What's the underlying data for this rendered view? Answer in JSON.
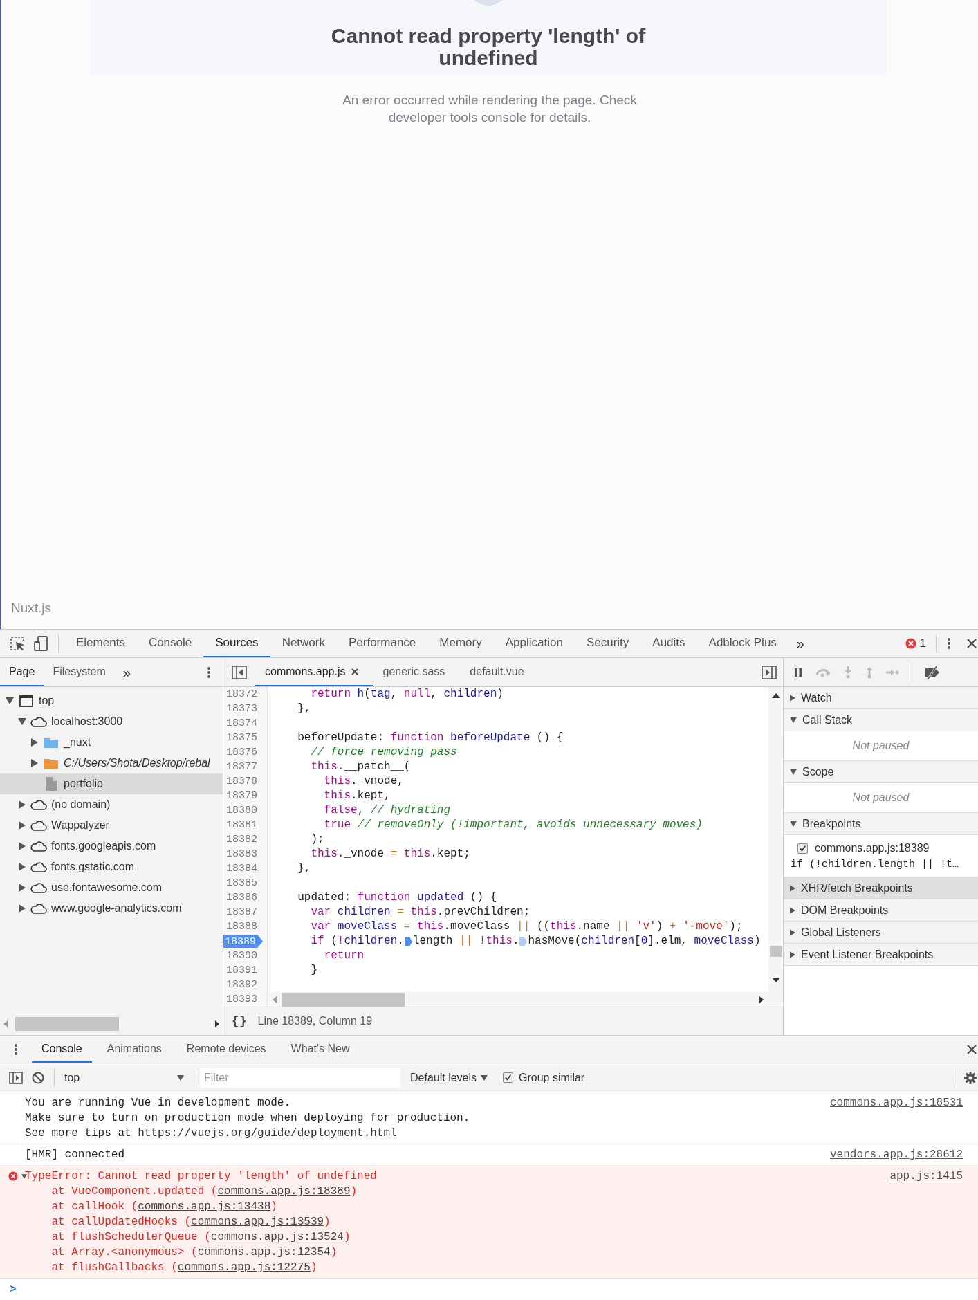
{
  "page": {
    "title": "Cannot read property 'length' of undefined",
    "message": "An error occurred while rendering the page. Check developer tools console for details.",
    "footer": "Nuxt.js"
  },
  "devtools": {
    "tabs": [
      {
        "label": "Elements",
        "selected": false
      },
      {
        "label": "Console",
        "selected": false
      },
      {
        "label": "Sources",
        "selected": true
      },
      {
        "label": "Network",
        "selected": false
      },
      {
        "label": "Performance",
        "selected": false
      },
      {
        "label": "Memory",
        "selected": false
      },
      {
        "label": "Application",
        "selected": false
      },
      {
        "label": "Security",
        "selected": false
      },
      {
        "label": "Audits",
        "selected": false
      },
      {
        "label": "Adblock Plus",
        "selected": false
      }
    ],
    "more_tabs": "»",
    "error_count": "1",
    "sources": {
      "navigator_tabs": [
        {
          "label": "Page",
          "selected": true
        },
        {
          "label": "Filesystem",
          "selected": false
        }
      ],
      "navigator_more": "»",
      "tree": [
        {
          "label": "top",
          "kind": "frame",
          "expanded": true,
          "selected": false,
          "children": [
            {
              "label": "localhost:3000",
              "kind": "domain",
              "expanded": true,
              "selected": false,
              "children": [
                {
                  "label": "_nuxt",
                  "kind": "folder",
                  "expanded": false,
                  "selected": false
                },
                {
                  "label": "C:/Users/Shota/Desktop/rebal",
                  "kind": "mapped-folder",
                  "expanded": false,
                  "selected": false
                },
                {
                  "label": "portfolio",
                  "kind": "file",
                  "selected": true
                }
              ]
            },
            {
              "label": "(no domain)",
              "kind": "domain",
              "expanded": false,
              "selected": false
            },
            {
              "label": "Wappalyzer",
              "kind": "domain",
              "expanded": false,
              "selected": false
            },
            {
              "label": "fonts.googleapis.com",
              "kind": "domain",
              "expanded": false,
              "selected": false
            },
            {
              "label": "fonts.gstatic.com",
              "kind": "domain",
              "expanded": false,
              "selected": false
            },
            {
              "label": "use.fontawesome.com",
              "kind": "domain",
              "expanded": false,
              "selected": false
            },
            {
              "label": "www.google-analytics.com",
              "kind": "domain",
              "expanded": false,
              "selected": false
            }
          ]
        }
      ],
      "editor_tabs": [
        {
          "label": "commons.app.js",
          "selected": true,
          "closable": true
        },
        {
          "label": "generic.sass",
          "selected": false,
          "closable": false
        },
        {
          "label": "default.vue",
          "selected": false,
          "closable": false
        }
      ],
      "code": [
        {
          "number": "18372",
          "breakpoint": false,
          "tokens": [
            {
              "kind": "keyword",
              "text": "    return"
            },
            {
              "kind": "name",
              "text": " h"
            },
            {
              "kind": "plain",
              "text": "("
            },
            {
              "kind": "name",
              "text": "tag"
            },
            {
              "kind": "plain",
              "text": ", "
            },
            {
              "kind": "keyword",
              "text": "null"
            },
            {
              "kind": "plain",
              "text": ", "
            },
            {
              "kind": "name",
              "text": "children"
            },
            {
              "kind": "plain",
              "text": ")"
            }
          ]
        },
        {
          "number": "18373",
          "breakpoint": false,
          "tokens": [
            {
              "kind": "plain",
              "text": "  },"
            }
          ]
        },
        {
          "number": "18374",
          "breakpoint": false
        },
        {
          "number": "18375",
          "breakpoint": false,
          "tokens": [
            {
              "kind": "plain",
              "text": "  beforeUpdate: "
            },
            {
              "kind": "keyword",
              "text": "function"
            },
            {
              "kind": "name",
              "text": " beforeUpdate"
            },
            {
              "kind": "plain",
              "text": " () {"
            }
          ]
        },
        {
          "number": "18376",
          "breakpoint": false,
          "tokens": [
            {
              "kind": "comment",
              "text": "    // force removing pass"
            }
          ]
        },
        {
          "number": "18377",
          "breakpoint": false,
          "tokens": [
            {
              "kind": "keyword",
              "text": "    this"
            },
            {
              "kind": "plain",
              "text": ".__patch__("
            }
          ]
        },
        {
          "number": "18378",
          "breakpoint": false,
          "tokens": [
            {
              "kind": "keyword",
              "text": "      this"
            },
            {
              "kind": "plain",
              "text": "._vnode,"
            }
          ]
        },
        {
          "number": "18379",
          "breakpoint": false,
          "tokens": [
            {
              "kind": "keyword",
              "text": "      this"
            },
            {
              "kind": "plain",
              "text": ".kept,"
            }
          ]
        },
        {
          "number": "18380",
          "breakpoint": false,
          "tokens": [
            {
              "kind": "keyword",
              "text": "      false"
            },
            {
              "kind": "plain",
              "text": ", "
            },
            {
              "kind": "comment",
              "text": "// hydrating"
            }
          ]
        },
        {
          "number": "18381",
          "breakpoint": false,
          "tokens": [
            {
              "kind": "keyword",
              "text": "      true"
            },
            {
              "kind": "comment",
              "text": " // removeOnly (!important, avoids unnecessary moves)"
            }
          ]
        },
        {
          "number": "18382",
          "breakpoint": false,
          "tokens": [
            {
              "kind": "plain",
              "text": "    );"
            }
          ]
        },
        {
          "number": "18383",
          "breakpoint": false,
          "tokens": [
            {
              "kind": "keyword",
              "text": "    this"
            },
            {
              "kind": "plain",
              "text": "._vnode "
            },
            {
              "kind": "operator",
              "text": "="
            },
            {
              "kind": "keyword",
              "text": " this"
            },
            {
              "kind": "plain",
              "text": ".kept;"
            }
          ]
        },
        {
          "number": "18384",
          "breakpoint": false,
          "tokens": [
            {
              "kind": "plain",
              "text": "  },"
            }
          ]
        },
        {
          "number": "18385",
          "breakpoint": false
        },
        {
          "number": "18386",
          "breakpoint": false,
          "tokens": [
            {
              "kind": "plain",
              "text": "  updated: "
            },
            {
              "kind": "keyword",
              "text": "function"
            },
            {
              "kind": "name",
              "text": " updated"
            },
            {
              "kind": "plain",
              "text": " () {"
            }
          ]
        },
        {
          "number": "18387",
          "breakpoint": false,
          "tokens": [
            {
              "kind": "keyword",
              "text": "    var"
            },
            {
              "kind": "name",
              "text": " children"
            },
            {
              "kind": "operator",
              "text": " ="
            },
            {
              "kind": "keyword",
              "text": " this"
            },
            {
              "kind": "plain",
              "text": ".prevChildren;"
            }
          ]
        },
        {
          "number": "18388",
          "breakpoint": false,
          "tokens": [
            {
              "kind": "keyword",
              "text": "    var"
            },
            {
              "kind": "name",
              "text": " moveClass"
            },
            {
              "kind": "operator",
              "text": " ="
            },
            {
              "kind": "keyword",
              "text": " this"
            },
            {
              "kind": "plain",
              "text": ".moveClass "
            },
            {
              "kind": "operator",
              "text": "||"
            },
            {
              "kind": "plain",
              "text": " (("
            },
            {
              "kind": "keyword",
              "text": "this"
            },
            {
              "kind": "plain",
              "text": ".name "
            },
            {
              "kind": "operator",
              "text": "||"
            },
            {
              "kind": "string",
              "text": " 'v'"
            },
            {
              "kind": "plain",
              "text": ") "
            },
            {
              "kind": "operator",
              "text": "+"
            },
            {
              "kind": "string",
              "text": " '-move'"
            },
            {
              "kind": "plain",
              "text": ");"
            }
          ]
        },
        {
          "number": "18389",
          "breakpoint": true,
          "tokens": [
            {
              "kind": "keyword",
              "text": "    if"
            },
            {
              "kind": "plain",
              "text": " ("
            },
            {
              "kind": "keyword",
              "text": "!"
            },
            {
              "kind": "name",
              "text": "children"
            },
            {
              "kind": "plain",
              "text": "."
            },
            {
              "kind": "marker",
              "enabled": true
            },
            {
              "kind": "plain",
              "text": "length "
            },
            {
              "kind": "operator",
              "text": "||"
            },
            {
              "kind": "keyword",
              "text": " !this"
            },
            {
              "kind": "plain",
              "text": "."
            },
            {
              "kind": "marker",
              "enabled": false
            },
            {
              "kind": "plain",
              "text": "hasMove("
            },
            {
              "kind": "name",
              "text": "children"
            },
            {
              "kind": "plain",
              "text": "["
            },
            {
              "kind": "number",
              "text": "0"
            },
            {
              "kind": "plain",
              "text": "].elm, "
            },
            {
              "kind": "name",
              "text": "moveClass"
            },
            {
              "kind": "plain",
              "text": ")"
            }
          ]
        },
        {
          "number": "18390",
          "breakpoint": false,
          "tokens": [
            {
              "kind": "keyword",
              "text": "      return"
            }
          ]
        },
        {
          "number": "18391",
          "breakpoint": false,
          "tokens": [
            {
              "kind": "plain",
              "text": "    }"
            }
          ]
        },
        {
          "number": "18392",
          "breakpoint": false
        },
        {
          "number": "18393",
          "breakpoint": false
        }
      ],
      "pretty_print": "{}",
      "cursor_position": "Line 18389, Column 19"
    },
    "debugger": {
      "sections": [
        {
          "title": "Watch",
          "expanded": false,
          "highlighted": false
        },
        {
          "title": "Call Stack",
          "expanded": true,
          "highlighted": false,
          "empty_text": "Not paused"
        },
        {
          "title": "Scope",
          "expanded": true,
          "highlighted": false,
          "empty_text": "Not paused"
        },
        {
          "title": "Breakpoints",
          "expanded": true,
          "highlighted": false,
          "breakpoints": [
            {
              "location": "commons.app.js:18389",
              "code": "if (!children.length || !t…",
              "checked": true
            }
          ]
        },
        {
          "title": "XHR/fetch Breakpoints",
          "expanded": false,
          "highlighted": true
        },
        {
          "title": "DOM Breakpoints",
          "expanded": false,
          "highlighted": false
        },
        {
          "title": "Global Listeners",
          "expanded": false,
          "highlighted": false
        },
        {
          "title": "Event Listener Breakpoints",
          "expanded": false,
          "highlighted": false
        }
      ]
    }
  },
  "drawer": {
    "tabs": [
      {
        "label": "Console",
        "selected": true
      },
      {
        "label": "Animations",
        "selected": false
      },
      {
        "label": "Remote devices",
        "selected": false
      },
      {
        "label": "What's New",
        "selected": false
      }
    ],
    "context": "top",
    "filter_placeholder": "Filter",
    "levels": "Default levels",
    "group_similar": {
      "label": "Group similar",
      "checked": true
    },
    "messages": [
      {
        "kind": "log",
        "source": "commons.app.js:18531",
        "lines": [
          [
            {
              "kind": "text",
              "text": "You are running Vue in development mode."
            }
          ],
          [
            {
              "kind": "text",
              "text": "Make sure to turn on production mode when deploying for production."
            }
          ],
          [
            {
              "kind": "text",
              "text": "See more tips at "
            },
            {
              "kind": "link",
              "text": "https://vuejs.org/guide/deployment.html"
            }
          ]
        ]
      },
      {
        "kind": "log",
        "source": "vendors.app.js:28612",
        "lines": [
          [
            {
              "kind": "text",
              "text": "[HMR] connected"
            }
          ]
        ]
      },
      {
        "kind": "error",
        "expanded": true,
        "source": "app.js:1415",
        "lines": [
          [
            {
              "kind": "text",
              "text": "TypeError: Cannot read property 'length' of undefined"
            }
          ],
          [
            {
              "kind": "text",
              "text": "    at VueComponent.updated ("
            },
            {
              "kind": "link",
              "text": "commons.app.js:18389"
            },
            {
              "kind": "text",
              "text": ")"
            }
          ],
          [
            {
              "kind": "text",
              "text": "    at callHook ("
            },
            {
              "kind": "link",
              "text": "commons.app.js:13438"
            },
            {
              "kind": "text",
              "text": ")"
            }
          ],
          [
            {
              "kind": "text",
              "text": "    at callUpdatedHooks ("
            },
            {
              "kind": "link",
              "text": "commons.app.js:13539"
            },
            {
              "kind": "text",
              "text": ")"
            }
          ],
          [
            {
              "kind": "text",
              "text": "    at flushSchedulerQueue ("
            },
            {
              "kind": "link",
              "text": "commons.app.js:13524"
            },
            {
              "kind": "text",
              "text": ")"
            }
          ],
          [
            {
              "kind": "text",
              "text": "    at Array.<anonymous> ("
            },
            {
              "kind": "link",
              "text": "commons.app.js:12354"
            },
            {
              "kind": "text",
              "text": ")"
            }
          ],
          [
            {
              "kind": "text",
              "text": "    at flushCallbacks ("
            },
            {
              "kind": "link",
              "text": "commons.app.js:12275"
            },
            {
              "kind": "text",
              "text": ")"
            }
          ]
        ]
      }
    ],
    "prompt": ">"
  }
}
